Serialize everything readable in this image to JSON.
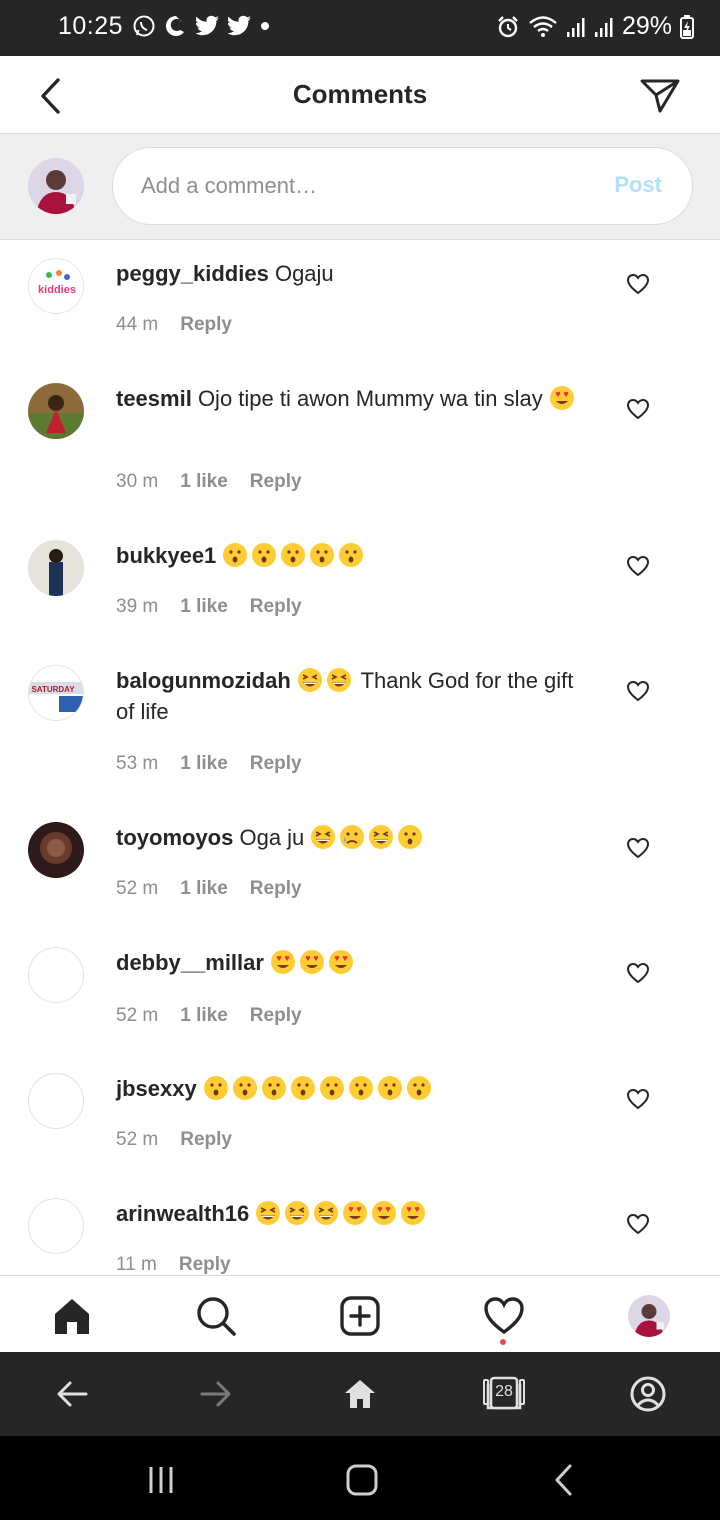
{
  "status_bar": {
    "time": "10:25",
    "battery": "29%",
    "icons": [
      "whatsapp-icon",
      "chat-icon",
      "twitter-icon",
      "twitter-icon",
      "dot-icon",
      "alarm-icon",
      "wifi-icon",
      "signal-icon",
      "signal-icon",
      "battery-icon"
    ]
  },
  "header": {
    "title": "Comments"
  },
  "composer": {
    "placeholder": "Add a comment…",
    "post_label": "Post"
  },
  "comments": [
    {
      "username": "peggy_kiddies",
      "text": " Ogaju",
      "emojis": [],
      "time": "44 m",
      "likes": "",
      "reply": "Reply"
    },
    {
      "username": "teesmil",
      "text": " Ojo tipe ti awon Mummy wa tin slay ",
      "emojis": [
        "heart-eyes"
      ],
      "time": "30 m",
      "likes": "1 like",
      "reply": "Reply"
    },
    {
      "username": "bukkyee1",
      "text": " ",
      "emojis": [
        "astonished",
        "astonished",
        "astonished",
        "astonished",
        "astonished"
      ],
      "time": "39 m",
      "likes": "1 like",
      "reply": "Reply"
    },
    {
      "username": "balogunmozidah",
      "text_before": " ",
      "emojis": [
        "grinning-squint",
        "grinning-squint"
      ],
      "text": " Thank God for the gift of life",
      "time": "53 m",
      "likes": "1 like",
      "reply": "Reply"
    },
    {
      "username": "toyomoyos",
      "text": " Oga ju ",
      "emojis": [
        "grinning-squint",
        "sad-tear",
        "grinning-squint",
        "astonished"
      ],
      "time": "52 m",
      "likes": "1 like",
      "reply": "Reply"
    },
    {
      "username": "debby__millar",
      "text": " ",
      "emojis": [
        "heart-eyes",
        "heart-eyes",
        "heart-eyes"
      ],
      "time": "52 m",
      "likes": "1 like",
      "reply": "Reply"
    },
    {
      "username": "jbsexxy",
      "text": " ",
      "emojis": [
        "astonished",
        "astonished",
        "astonished",
        "astonished",
        "astonished",
        "astonished",
        "astonished",
        "astonished"
      ],
      "time": "52 m",
      "likes": "",
      "reply": "Reply"
    },
    {
      "username": "arinwealth16",
      "text": " ",
      "emojis": [
        "grinning-squint",
        "grinning-squint",
        "grinning-squint",
        "heart-eyes",
        "heart-eyes",
        "heart-eyes"
      ],
      "time": "11 m",
      "likes": "",
      "reply": "Reply"
    }
  ],
  "browser_bar": {
    "tab_count": "28"
  },
  "colors": {
    "accent_disabled": "#b2dffc",
    "notification_dot": "#ed4956",
    "secondary_text": "#8e8e8e"
  }
}
